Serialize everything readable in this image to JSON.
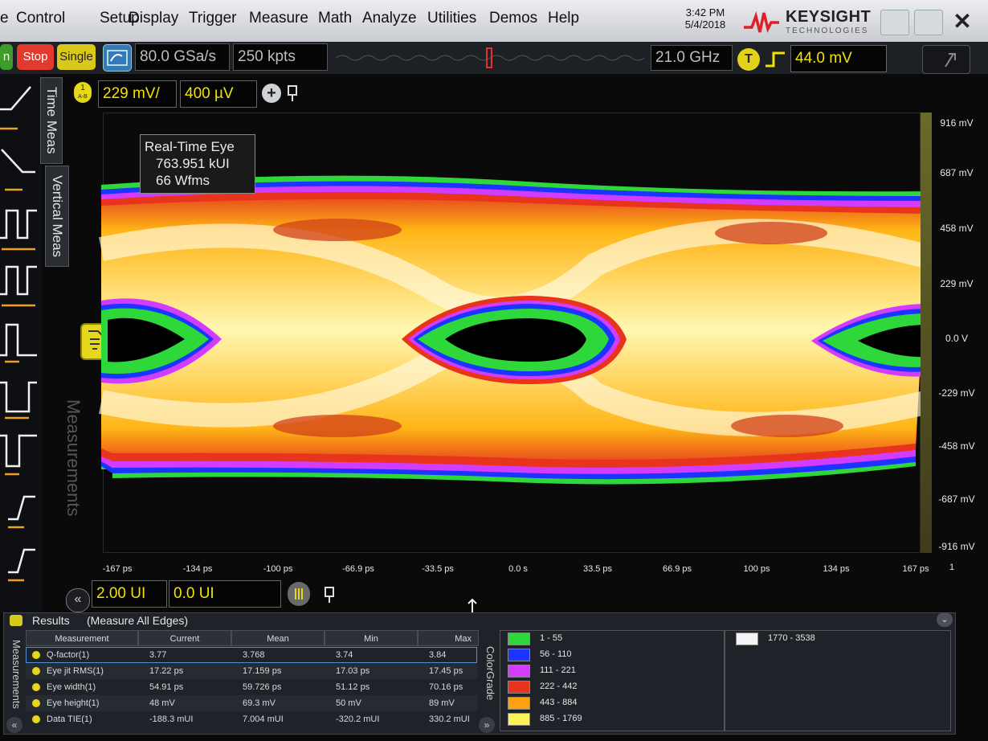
{
  "menu": [
    "e",
    "Control",
    "Setup",
    "Display",
    "Trigger",
    "Measure",
    "Math",
    "Analyze",
    "Utilities",
    "Demos",
    "Help"
  ],
  "clock": {
    "time": "3:42 PM",
    "date": "5/4/2018"
  },
  "brand": {
    "name": "KEYSIGHT",
    "sub": "TECHNOLOGIES"
  },
  "window": {
    "close": "✕"
  },
  "toolbar": {
    "run_label": "n",
    "stop_label": "Stop",
    "single_label": "Single",
    "sample_rate": "80.0 GSa/s",
    "memory_depth": "250 kpts",
    "bandwidth": "21.0 GHz",
    "trigger_badge": "T",
    "trigger_level": "44.0 mV"
  },
  "channel": {
    "badge": "1",
    "badge_sub": "A-B",
    "scale": "229 mV/",
    "offset": "400 µV"
  },
  "side_tabs": {
    "time_meas": "Time Meas",
    "vertical_meas": "Vertical Meas",
    "measurements": "Measurements"
  },
  "eye_info": {
    "title": "Real-Time Eye",
    "ui_count": "763.951 kUI",
    "waveforms": "66 Wfms"
  },
  "y_axis": [
    "916 mV",
    "687 mV",
    "458 mV",
    "229 mV",
    "0.0 V",
    "-229 mV",
    "-458 mV",
    "-687 mV",
    "-916 mV"
  ],
  "x_axis": [
    "-167 ps",
    "-134 ps",
    "-100 ps",
    "-66.9 ps",
    "-33.5 ps",
    "0.0 s",
    "33.5 ps",
    "66.9 ps",
    "100 ps",
    "134 ps",
    "167 ps"
  ],
  "x_axis_end": "1",
  "horizontal": {
    "scale": "2.00 UI",
    "position": "0.0 UI"
  },
  "results": {
    "title": "Results",
    "subtitle": "(Measure All Edges)",
    "side_label": "Measurements",
    "colorgrade_label": "ColorGrade",
    "columns": [
      "Measurement",
      "Current",
      "Mean",
      "Min",
      "Max"
    ],
    "rows": [
      {
        "name": "Q-factor(1)",
        "current": "3.77",
        "mean": "3.768",
        "min": "3.74",
        "max": "3.84"
      },
      {
        "name": "Eye jit RMS(1)",
        "current": "17.22 ps",
        "mean": "17.159 ps",
        "min": "17.03 ps",
        "max": "17.45 ps"
      },
      {
        "name": "Eye width(1)",
        "current": "54.91 ps",
        "mean": "59.726 ps",
        "min": "51.12 ps",
        "max": "70.16 ps"
      },
      {
        "name": "Eye height(1)",
        "current": "48 mV",
        "mean": "69.3 mV",
        "min": "50 mV",
        "max": "89 mV"
      },
      {
        "name": "Data TIE(1)",
        "current": "-188.3 mUI",
        "mean": "7.004 mUI",
        "min": "-320.2 mUI",
        "max": "330.2 mUI"
      }
    ]
  },
  "colorgrade": [
    {
      "range": "1 - 55",
      "color": "#2fd83a"
    },
    {
      "range": "56 - 110",
      "color": "#1b34ff"
    },
    {
      "range": "111 - 221",
      "color": "#d23cff"
    },
    {
      "range": "222 - 442",
      "color": "#e8341c"
    },
    {
      "range": "443 - 884",
      "color": "#ffa010"
    },
    {
      "range": "885 - 1769",
      "color": "#fff15a"
    },
    {
      "range": "1770 - 3538",
      "color": "#f4f4f4"
    }
  ],
  "icons": {
    "stop": "stop-button",
    "zoom": "zoom-icon",
    "add": "plus-icon",
    "pin": "pin-icon"
  }
}
